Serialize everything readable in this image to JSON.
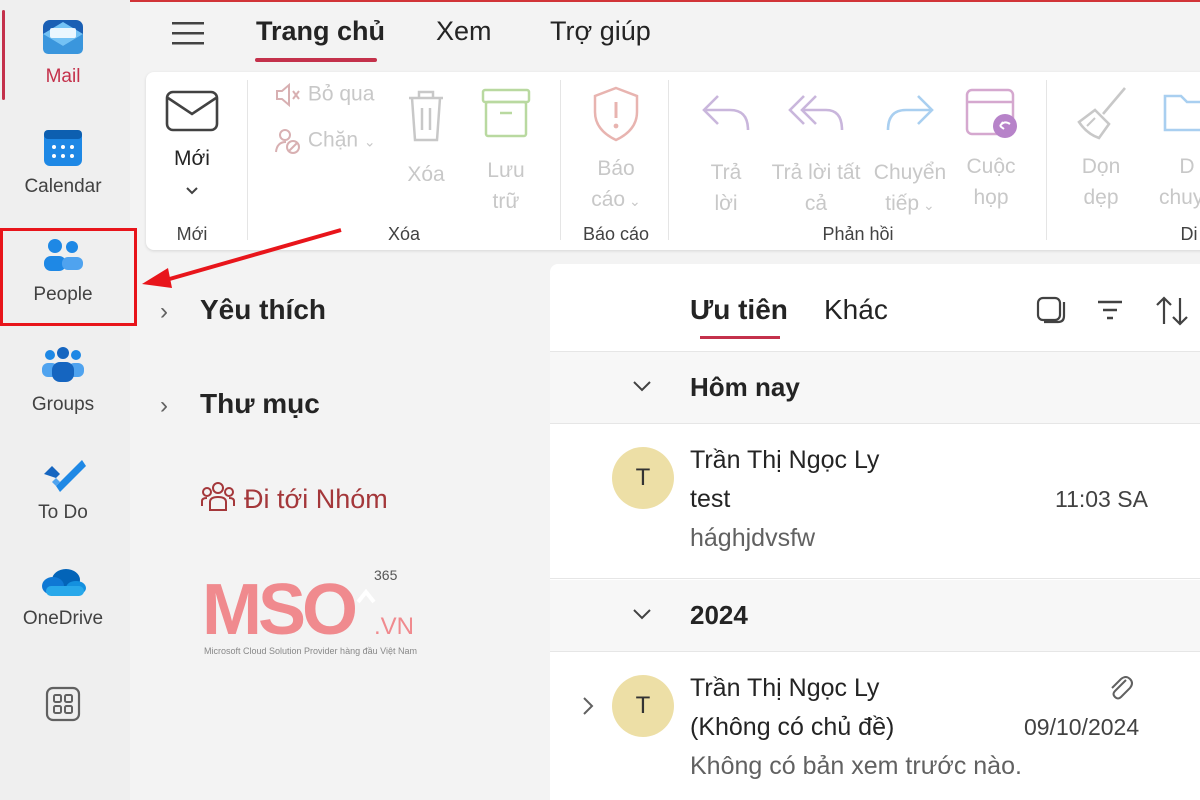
{
  "rail": {
    "items": [
      {
        "label": "Mail"
      },
      {
        "label": "Calendar"
      },
      {
        "label": "People"
      },
      {
        "label": "Groups"
      },
      {
        "label": "To Do"
      },
      {
        "label": "OneDrive"
      }
    ]
  },
  "tabs": [
    {
      "label": "Trang chủ"
    },
    {
      "label": "Xem"
    },
    {
      "label": "Trợ giúp"
    }
  ],
  "ribbon": {
    "new": {
      "label": "Mới",
      "group": "Mới"
    },
    "ignore": "Bỏ qua",
    "block": "Chặn",
    "delete": "Xóa",
    "archive": [
      "Lưu",
      "trữ"
    ],
    "delete_group": "Xóa",
    "report": [
      "Báo",
      "cáo"
    ],
    "report_group": "Báo cáo",
    "reply": [
      "Trả",
      "lời"
    ],
    "reply_all": [
      "Trả lời tất",
      "cả"
    ],
    "forward": [
      "Chuyển",
      "tiếp"
    ],
    "meeting": [
      "Cuộc",
      "họp"
    ],
    "respond_group": "Phản hồi",
    "sweep": [
      "Dọn",
      "dẹp"
    ],
    "move": [
      "D",
      "chuyể"
    ],
    "move_group": "Di chu"
  },
  "folders": {
    "favorites": "Yêu thích",
    "folders": "Thư mục",
    "go_to_groups": "Đi tới Nhóm"
  },
  "logo": {
    "text": "MSO",
    "suffix": ".VN",
    "superscript": "365",
    "tagline": "Microsoft Cloud Solution Provider hàng đầu Việt Nam"
  },
  "list": {
    "focused": "Ưu tiên",
    "other": "Khác",
    "sections": [
      {
        "title": "Hôm nay",
        "items": [
          {
            "avatar": "T",
            "sender": "Trần Thị Ngọc Ly",
            "subject": "test",
            "preview": "hághjdvsfw",
            "time": "11:03 SA"
          }
        ]
      },
      {
        "title": "2024",
        "items": [
          {
            "avatar": "T",
            "sender": "Trần Thị Ngọc Ly",
            "subject": "(Không có chủ đề)",
            "preview": "Không có bản xem trước nào.",
            "time": "09/10/2024"
          }
        ]
      }
    ]
  },
  "colors": {
    "accent": "#c4314b",
    "highlight": "#e8151b"
  }
}
